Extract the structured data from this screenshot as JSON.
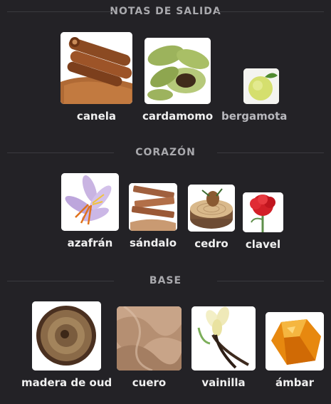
{
  "sections": {
    "top": "NOTAS DE SALIDA",
    "heart": "CORAZÓN",
    "base": "BASE"
  },
  "notes": {
    "canela": {
      "label": "canela",
      "icon": "cinnamon-image"
    },
    "cardamomo": {
      "label": "cardamomo",
      "icon": "cardamom-image"
    },
    "bergamota": {
      "label": "bergamota",
      "icon": "bergamot-image"
    },
    "azafran": {
      "label": "azafrán",
      "icon": "saffron-image"
    },
    "sandalo": {
      "label": "sándalo",
      "icon": "sandalwood-image"
    },
    "cedro": {
      "label": "cedro",
      "icon": "cedar-image"
    },
    "clavel": {
      "label": "clavel",
      "icon": "carnation-image"
    },
    "oud": {
      "label": "madera de oud",
      "icon": "oud-wood-image"
    },
    "cuero": {
      "label": "cuero",
      "icon": "leather-image"
    },
    "vainilla": {
      "label": "vainilla",
      "icon": "vanilla-image"
    },
    "ambar": {
      "label": "ámbar",
      "icon": "amber-image"
    }
  },
  "colors": {
    "background": "#232226",
    "section_title": "#a9a9ad",
    "label": "#f0f0f0"
  }
}
